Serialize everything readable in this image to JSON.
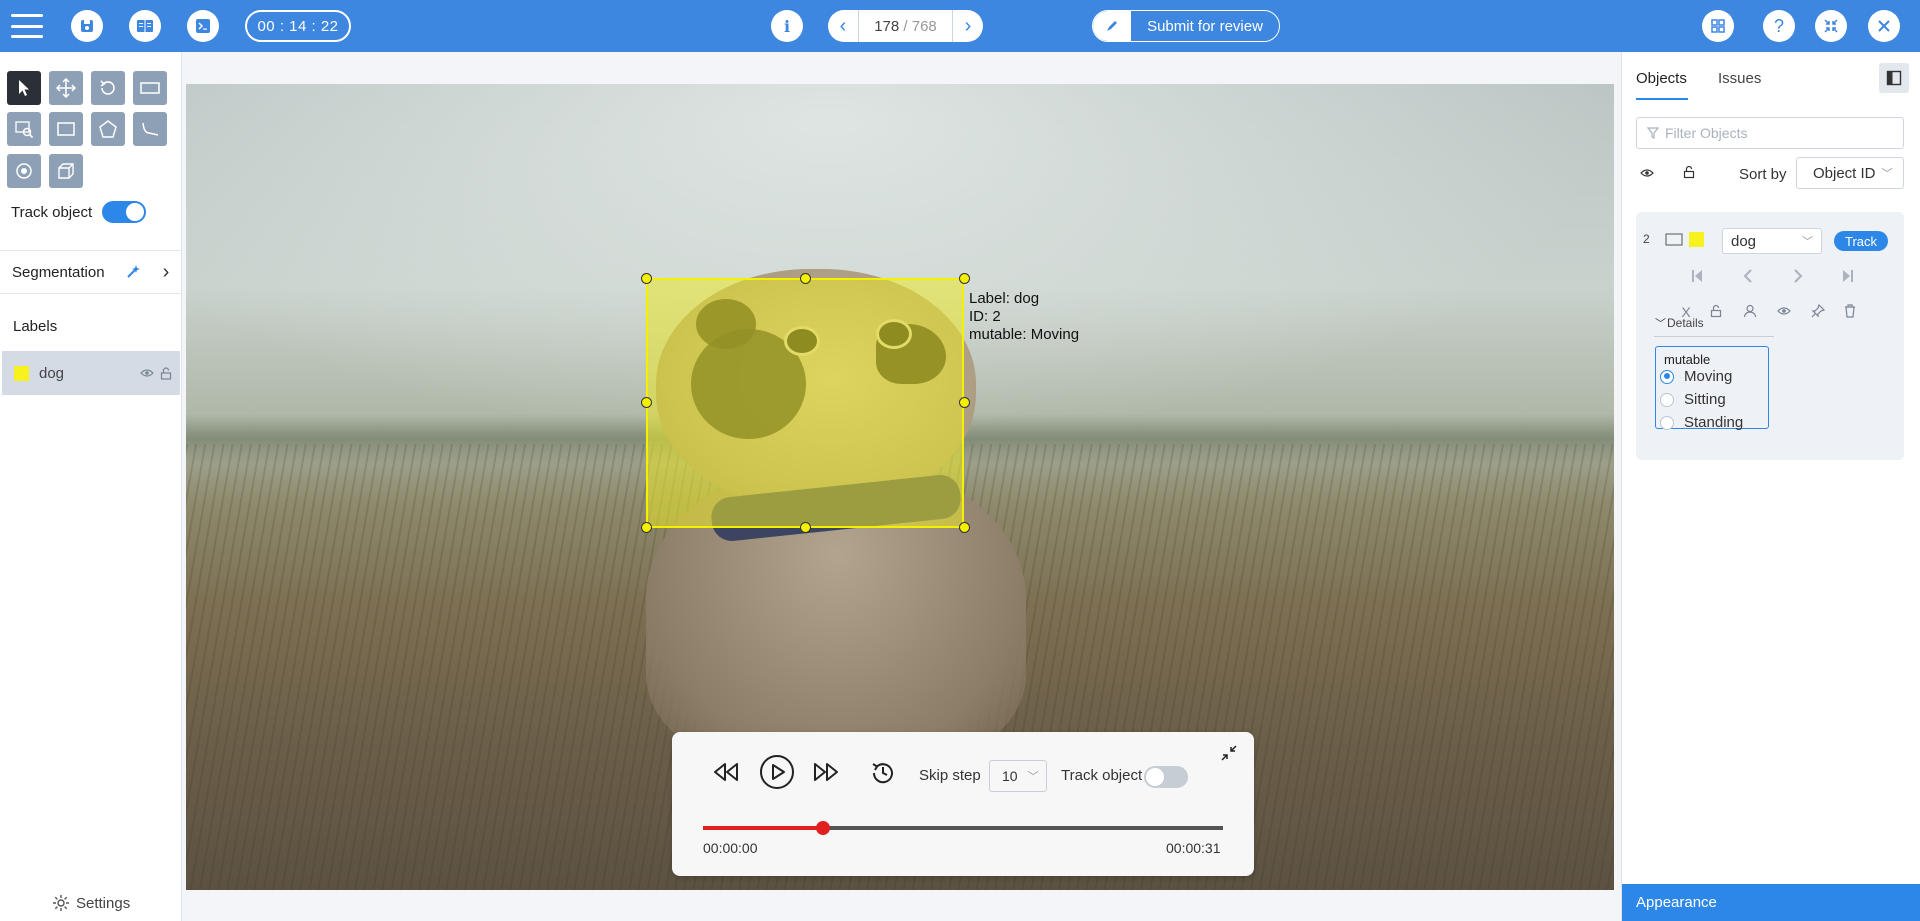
{
  "topbar": {
    "timer": "00 : 14 : 22",
    "frame_current": "178",
    "frame_total": "/ 768",
    "submit_label": "Submit for review"
  },
  "left_panel": {
    "track_object_label": "Track object",
    "track_object_on": true,
    "segmentation_label": "Segmentation",
    "labels_title": "Labels",
    "labels": [
      {
        "name": "dog",
        "color": "#f7f21f"
      }
    ],
    "settings_label": "Settings"
  },
  "canvas": {
    "annotation": {
      "label_line": "Label: dog",
      "id_line": "ID: 2",
      "attr_line": "mutable: Moving",
      "color": "#f4f000"
    }
  },
  "player": {
    "skip_step_label": "Skip step",
    "skip_step_value": "10",
    "track_object_label": "Track object",
    "track_object_on": false,
    "time_start": "00:00:00",
    "time_end": "00:00:31",
    "progress_fraction": 0.23
  },
  "right_panel": {
    "tabs": [
      "Objects",
      "Issues"
    ],
    "active_tab": "Objects",
    "filter_placeholder": "Filter Objects",
    "sort_label": "Sort by",
    "sort_value": "Object ID",
    "object": {
      "id": "2",
      "label": "dog",
      "color": "#f7f21f",
      "track_label": "Track",
      "details_label": "Details",
      "attribute_name": "mutable",
      "options": [
        "Moving",
        "Sitting",
        "Standing"
      ],
      "selected": "Moving"
    },
    "appearance_label": "Appearance"
  },
  "colors": {
    "accent": "#3d87e0",
    "primary": "#2d87e8",
    "progress": "#e01f1f"
  }
}
